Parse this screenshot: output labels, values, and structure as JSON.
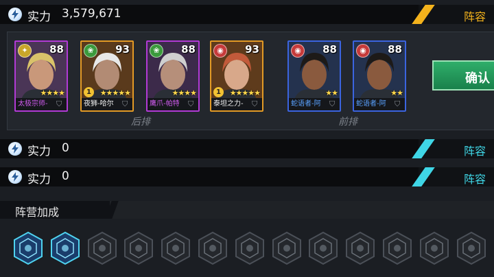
{
  "lineups": [
    {
      "power_label": "实力",
      "power_value": "3,579,671",
      "tab_label": "阵容",
      "accent": "#f3b21c"
    },
    {
      "power_label": "实力",
      "power_value": "0",
      "tab_label": "阵容",
      "accent": "#3fd6e6"
    },
    {
      "power_label": "实力",
      "power_value": "0",
      "tab_label": "阵容",
      "accent": "#3fd6e6"
    }
  ],
  "row_labels": {
    "back": "后排",
    "front": "前排"
  },
  "confirm_label": "确认",
  "heroes": [
    {
      "name": "太极宗师-",
      "level": "88",
      "stars": 4,
      "badge": "",
      "frame": "#b23ad6",
      "name_color": "#d15cf0",
      "element": "wind-icon",
      "element_color": "#c9a629",
      "portrait": "blonde-glasses-hero"
    },
    {
      "name": "夜狮-哈尔",
      "level": "93",
      "stars": 5,
      "badge": "1",
      "frame": "#e39a25",
      "name_color": "#f0f0f0",
      "element": "leaf-icon",
      "element_color": "#3b9a3c",
      "portrait": "masked-white-hair-hero"
    },
    {
      "name": "鹰爪-帕特",
      "level": "88",
      "stars": 4,
      "badge": "",
      "frame": "#b23ad6",
      "name_color": "#d15cf0",
      "element": "leaf-icon",
      "element_color": "#3b9a3c",
      "portrait": "eyepatch-hero"
    },
    {
      "name": "泰坦之力-",
      "level": "93",
      "stars": 5,
      "badge": "1",
      "frame": "#e39a25",
      "name_color": "#f0f0f0",
      "element": "flame-icon",
      "element_color": "#c63a3a",
      "portrait": "goggles-redhead-hero"
    },
    {
      "name": "蛇语者-阿",
      "level": "88",
      "stars": 2,
      "badge": "",
      "frame": "#3b64e0",
      "name_color": "#5aa2ff",
      "element": "flame-icon",
      "element_color": "#c63a3a",
      "portrait": "snake-charmer-hero"
    },
    {
      "name": "蛇语者-阿",
      "level": "88",
      "stars": 2,
      "badge": "",
      "frame": "#3b64e0",
      "name_color": "#5aa2ff",
      "element": "flame-icon",
      "element_color": "#c63a3a",
      "portrait": "snake-charmer-hero"
    }
  ],
  "faction": {
    "title": "阵营加成",
    "icons": [
      {
        "name": "wolf-faction-icon",
        "active": true
      },
      {
        "name": "beast-faction-icon",
        "active": true
      },
      {
        "name": "gear-faction-icon",
        "active": false
      },
      {
        "name": "eagle-faction-icon",
        "active": false
      },
      {
        "name": "claw-faction-icon",
        "active": false
      },
      {
        "name": "crown-faction-icon",
        "active": false
      },
      {
        "name": "spike-faction-icon",
        "active": false
      },
      {
        "name": "helmet-faction-icon",
        "active": false
      },
      {
        "name": "fist-faction-icon",
        "active": false
      },
      {
        "name": "skull-faction-icon",
        "active": false
      },
      {
        "name": "spiral-faction-icon",
        "active": false
      },
      {
        "name": "wing-faction-icon",
        "active": false
      },
      {
        "name": "shield-faction-icon",
        "active": false
      }
    ]
  }
}
